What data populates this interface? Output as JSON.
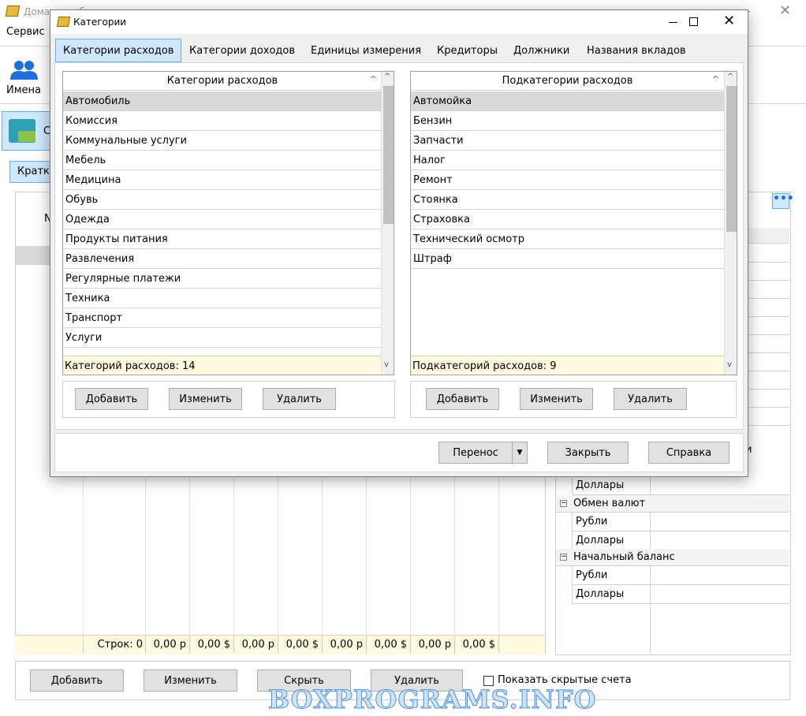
{
  "main_window": {
    "title": "Домашняя бухгалтерия",
    "menu": [
      "Сервис"
    ],
    "ribbon_names_label": "Имена",
    "section_letter": "С",
    "summary_tab_partial": "Кратко",
    "col_header_partial": "N",
    "totals": {
      "rows_label": "Строк: 0",
      "values": [
        "0,00 р",
        "0,00 $",
        "0,00 р",
        "0,00 $",
        "0,00 р",
        "0,00 $",
        "0,00 р",
        "0,00 $"
      ]
    },
    "tree": {
      "partial_top": "и",
      "dollars_1": "Доллары",
      "exchange": "Обмен валют",
      "rubles_2": "Рубли",
      "dollars_2": "Доллары",
      "initial_balance": "Начальный баланс",
      "rubles_3": "Рубли",
      "dollars_3": "Доллары"
    },
    "bottom_buttons": {
      "add": "Добавить",
      "edit": "Изменить",
      "hide": "Скрыть",
      "delete": "Удалить",
      "show_hidden": "Показать скрытые счета"
    }
  },
  "dialog": {
    "title": "Категории",
    "tabs": [
      "Категории расходов",
      "Категории доходов",
      "Единицы измерения",
      "Кредиторы",
      "Должники",
      "Названия вкладов"
    ],
    "left_list": {
      "header": "Категории расходов",
      "items": [
        "Автомобиль",
        "Комиссия",
        "Коммунальные услуги",
        "Мебель",
        "Медицина",
        "Обувь",
        "Одежда",
        "Продукты питания",
        "Развлечения",
        "Регулярные платежи",
        "Техника",
        "Транспорт",
        "Услуги"
      ],
      "status": "Категорий расходов: 14"
    },
    "right_list": {
      "header": "Подкатегории расходов",
      "items": [
        "Автомойка",
        "Бензин",
        "Запчасти",
        "Налог",
        "Ремонт",
        "Стоянка",
        "Страховка",
        "Технический осмотр",
        "Штраф"
      ],
      "status": "Подкатегорий расходов: 9"
    },
    "list_buttons": {
      "add": "Добавить",
      "edit": "Изменить",
      "delete": "Удалить"
    },
    "footer": {
      "transfer": "Перенос",
      "close": "Закрыть",
      "help": "Справка"
    }
  },
  "watermark": "BOXPROGRAMS.INFO",
  "colors": {
    "accent": "#cde8ff",
    "status_bg": "#fffbe0",
    "selection": "#d9d9d9"
  }
}
